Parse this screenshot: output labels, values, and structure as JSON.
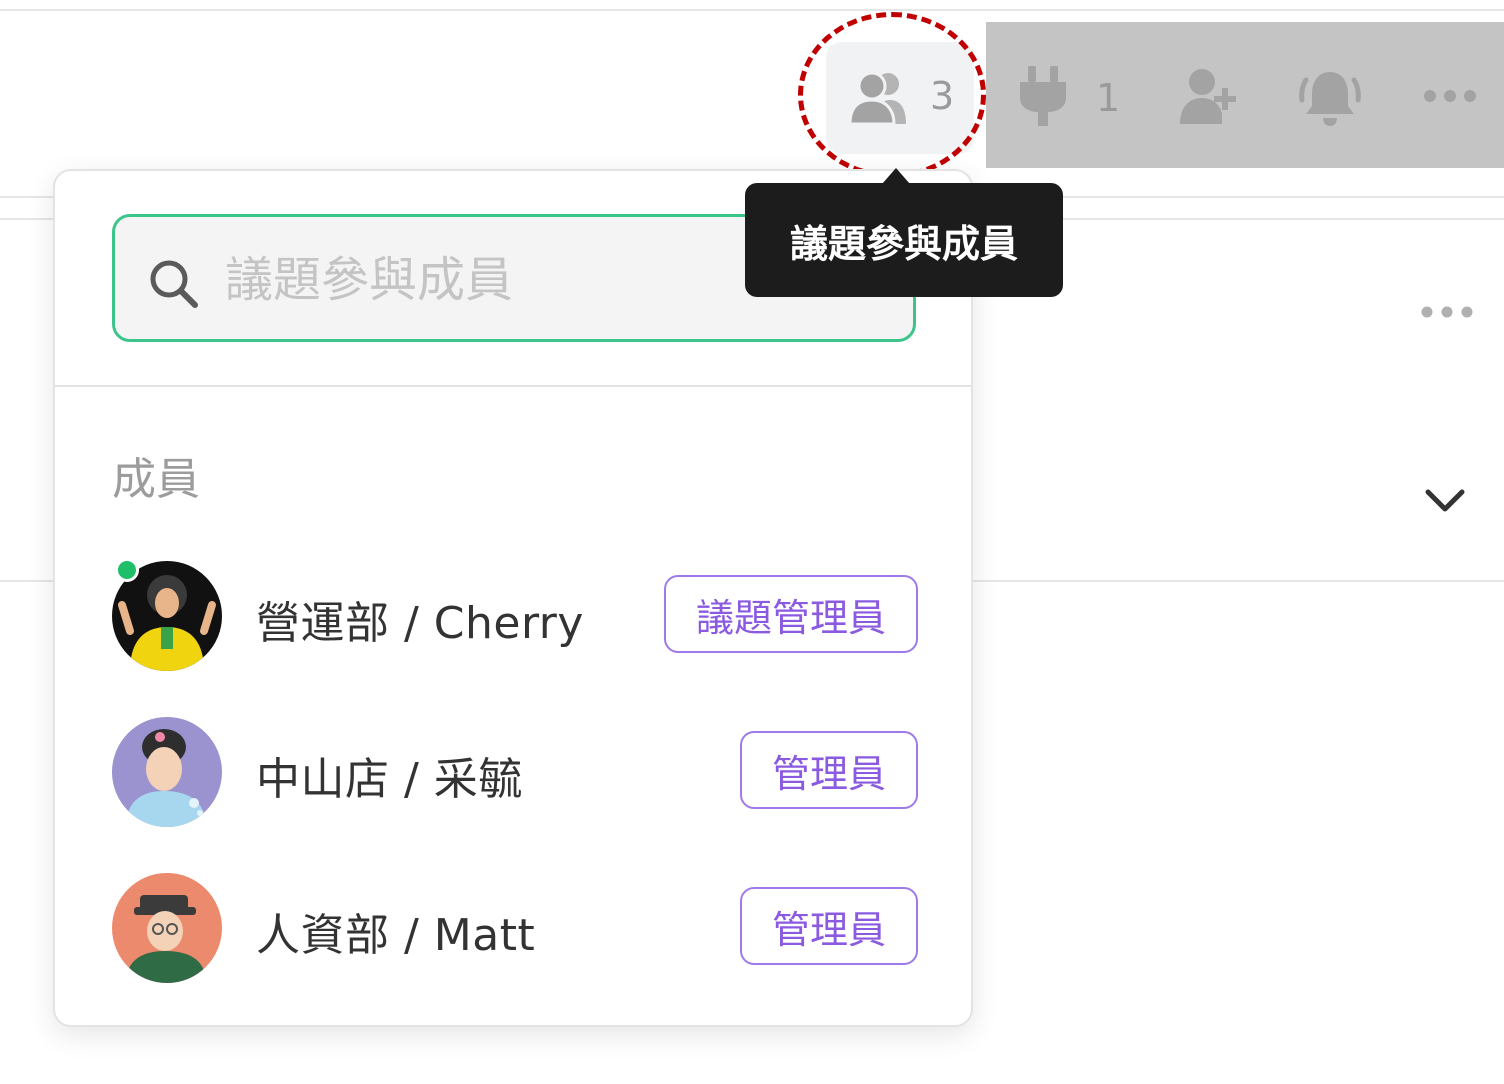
{
  "toolbar": {
    "members_count": "3",
    "plugins_count": "1"
  },
  "tooltip": {
    "text": "議題參與成員"
  },
  "dropdown": {
    "search_placeholder": "議題參與成員",
    "section_title": "成員",
    "members": [
      {
        "name": "營運部 / Cherry",
        "role": "議題管理員",
        "online": true
      },
      {
        "name": "中山店 / 采毓",
        "role": "管理員",
        "online": false
      },
      {
        "name": "人資部 / Matt",
        "role": "管理員",
        "online": false
      }
    ]
  },
  "colors": {
    "search_border": "#3cc58a",
    "role_badge": "#8a5ae0",
    "online": "#1fbf6a",
    "tooltip_bg": "#1c1c1c",
    "highlight": "#c00000"
  },
  "icons": {
    "members": "users-icon",
    "plugins": "plug-icon",
    "invite": "user-plus-icon",
    "notifications": "bell-ringing-icon",
    "more": "more-horizontal-icon",
    "search": "search-icon",
    "expand": "chevron-down-icon"
  }
}
